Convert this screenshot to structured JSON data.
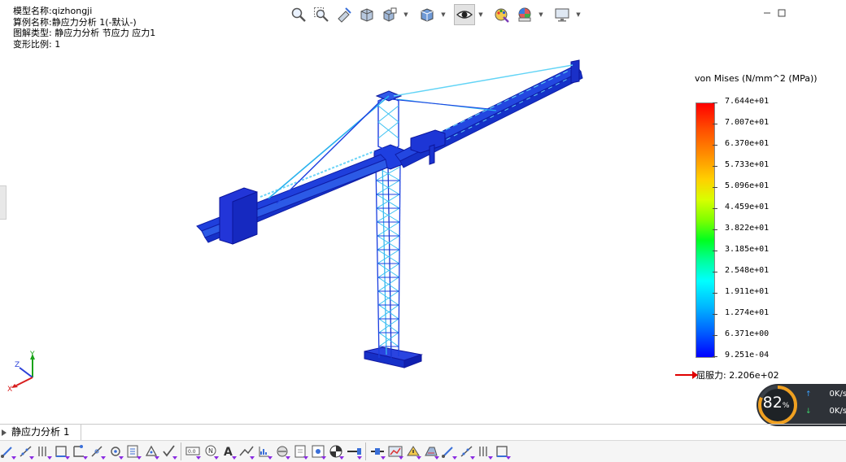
{
  "info": {
    "model": "模型名称:qizhongji",
    "study": "算例名称:静应力分析 1(-默认-)",
    "plot_type": "图解类型: 静应力分析 节应力 应力1",
    "deform_scale": "变形比例: 1"
  },
  "top_toolbar": {
    "buttons": [
      "zoom-to-fit-icon",
      "zoom-area-icon",
      "previous-view-icon",
      "section-view-icon",
      "view-orientation-icon",
      "display-style-icon",
      "hide-show-icon",
      "edit-appearance-icon",
      "apply-scene-icon",
      "view-settings-icon"
    ],
    "active": "hide-show-icon"
  },
  "legend": {
    "title": "von Mises (N/mm^2 (MPa))",
    "labels": [
      "7.644e+01",
      "7.007e+01",
      "6.370e+01",
      "5.733e+01",
      "5.096e+01",
      "4.459e+01",
      "3.822e+01",
      "3.185e+01",
      "2.548e+01",
      "1.911e+01",
      "1.274e+01",
      "6.371e+00",
      "9.251e-04"
    ],
    "yield": "屈服力: 2.206e+02",
    "colors": [
      "#ff0000",
      "#ffd000",
      "#00ff20",
      "#00ffff",
      "#0000ff"
    ]
  },
  "triad": {
    "y": "Y",
    "z": "Z",
    "x": "X"
  },
  "network": {
    "percent": "82",
    "percent_unit": "%",
    "up": "0K/s",
    "down": "0K/s"
  },
  "tabs": {
    "study_tab": "静应力分析 1"
  },
  "bottom_toolbar": {
    "icons": [
      "fixture-icon",
      "roller-icon",
      "hinge-icon",
      "elastic-support-icon",
      "bearing-icon",
      "bolt-icon",
      "pin-icon",
      "spring-icon",
      "force-icon",
      "torque-icon",
      "pressure-icon",
      "gravity-icon",
      "centrifugal-icon",
      "remote-load-icon",
      "distributed-mass-icon",
      "contact-icon",
      "connector-icon",
      "mesh-icon",
      "probe-icon",
      "list-icon",
      "report-icon",
      "plot-tool-icon",
      "compare-icon",
      "section-clip-icon",
      "iso-clip-icon",
      "animate-icon",
      "deformed-icon",
      "chart-icon"
    ]
  }
}
